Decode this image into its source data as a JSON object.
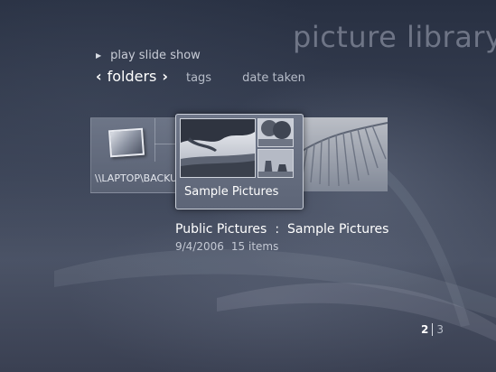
{
  "header": {
    "title": "picture library"
  },
  "actions": {
    "play_slide_show": "play slide show"
  },
  "pivots": {
    "active": "folders",
    "tags": "tags",
    "date_taken": "date taken"
  },
  "gallery": {
    "items": [
      {
        "label": "\\\\LAPTOP\\BACKU"
      },
      {
        "label": "Sample Pictures"
      }
    ]
  },
  "details": {
    "path_parent": "Public Pictures",
    "path_separator": ":",
    "path_current": "Sample Pictures",
    "date": "9/4/2006",
    "count": "15 items"
  },
  "pager": {
    "current": "2",
    "total": "3"
  }
}
